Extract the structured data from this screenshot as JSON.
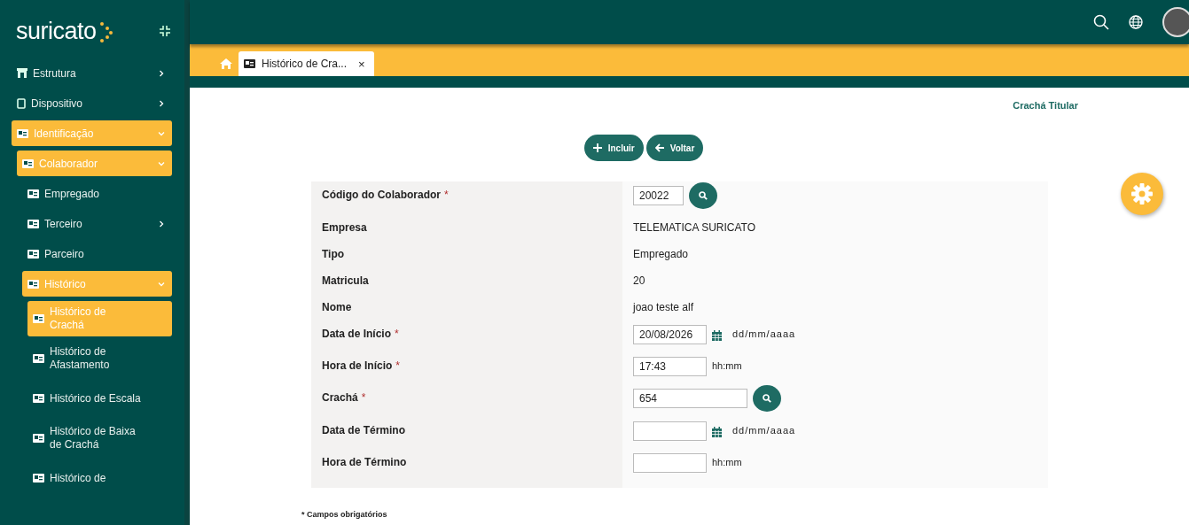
{
  "sidebar": {
    "logo": "suricato",
    "items": [
      {
        "label": "Estrutura",
        "has_submenu": true,
        "expanded": false
      },
      {
        "label": "Dispositivo",
        "has_submenu": true,
        "expanded": false
      },
      {
        "label": "Identificação",
        "has_submenu": true,
        "expanded": true,
        "children": [
          {
            "label": "Colaborador",
            "has_submenu": true,
            "expanded": true,
            "children": [
              {
                "label": "Empregado",
                "has_submenu": false,
                "selected": false
              },
              {
                "label": "Terceiro",
                "has_submenu": true,
                "expanded": false
              },
              {
                "label": "Parceiro",
                "has_submenu": false,
                "selected": false
              },
              {
                "label": "Histórico",
                "has_submenu": true,
                "expanded": true,
                "children": [
                  {
                    "label": "Histórico de Crachá",
                    "has_submenu": false,
                    "selected": true
                  },
                  {
                    "label": "Histórico de Afastamento",
                    "has_submenu": false,
                    "selected": false
                  },
                  {
                    "label": "Histórico de Escala",
                    "has_submenu": false,
                    "selected": false
                  },
                  {
                    "label": "Histórico de Baixa de Crachá",
                    "has_submenu": false,
                    "selected": false
                  },
                  {
                    "label": "Histórico de",
                    "has_submenu": false,
                    "selected": false
                  }
                ]
              }
            ]
          }
        ]
      }
    ]
  },
  "tabs": [
    {
      "label": "Histórico de Cra...",
      "selected": true,
      "close": "×"
    }
  ],
  "page": {
    "link": "Crachá Titular",
    "buttons": [
      {
        "label": "Incluir"
      },
      {
        "label": "Voltar"
      }
    ],
    "fields": [
      {
        "label": "Código do Colaborador",
        "required": true,
        "kind": "lookup",
        "value": "20022"
      },
      {
        "label": "Empresa",
        "required": false,
        "kind": "text",
        "value": "TELEMATICA SURICATO"
      },
      {
        "label": "Tipo",
        "required": false,
        "kind": "text",
        "value": "Empregado"
      },
      {
        "label": "Matricula",
        "required": false,
        "kind": "text",
        "value": "20"
      },
      {
        "label": "Nome",
        "required": false,
        "kind": "text",
        "value": "joao teste alf"
      },
      {
        "label": "Data de Início",
        "required": true,
        "kind": "date",
        "value": "20/08/2026",
        "hint": "dd/mm/aaaa"
      },
      {
        "label": "Hora de Início",
        "required": true,
        "kind": "time",
        "value": "17:43",
        "hint": "hh:mm"
      },
      {
        "label": "Crachá",
        "required": true,
        "kind": "lookup",
        "value": "654"
      },
      {
        "label": "Data de Término",
        "required": false,
        "kind": "date",
        "hint": "dd/mm/aaaa"
      },
      {
        "label": "Hora de Término",
        "required": false,
        "kind": "time",
        "hint": "hh:mm"
      }
    ],
    "required_mark": "*",
    "footnote": "* Campos obrigatórios"
  }
}
